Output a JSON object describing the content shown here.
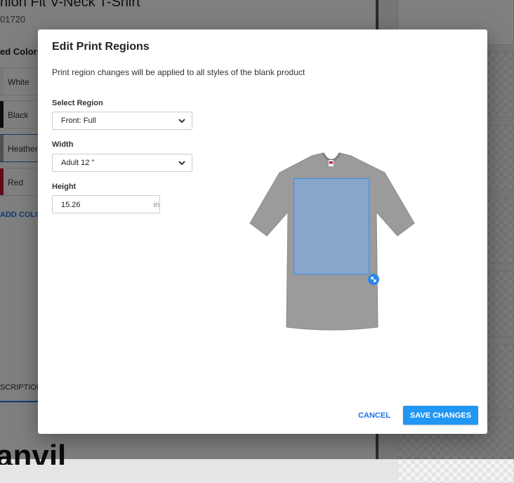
{
  "background": {
    "product_title": "nion Fit V-Neck T-Shirt",
    "sku": "01720",
    "colors_heading": "ed Colors",
    "colors": [
      {
        "label": "White",
        "hex": "#ffffff"
      },
      {
        "label": "Black",
        "hex": "#1a1a1a"
      },
      {
        "label": "Heather",
        "hex": "#9e9e9e"
      },
      {
        "label": "Red",
        "hex": "#c8102e"
      }
    ],
    "add_color": "ADD COLO",
    "description_tab": "SCRIPTION",
    "logo": "anvil"
  },
  "modal": {
    "title": "Edit Print Regions",
    "subtitle": "Print region changes will be applied to all styles of the blank product",
    "region": {
      "label": "Select Region",
      "value": "Front: Full"
    },
    "width": {
      "label": "Width",
      "value": "Adult 12 \""
    },
    "height": {
      "label": "Height",
      "value": "15.26",
      "unit": "in"
    },
    "cancel_label": "CANCEL",
    "save_label": "SAVE CHANGES"
  },
  "colors": {
    "accent": "#2196f3",
    "link": "#1e73e8",
    "shirt": "#9b9b9b",
    "print_region": "#78aff0"
  }
}
